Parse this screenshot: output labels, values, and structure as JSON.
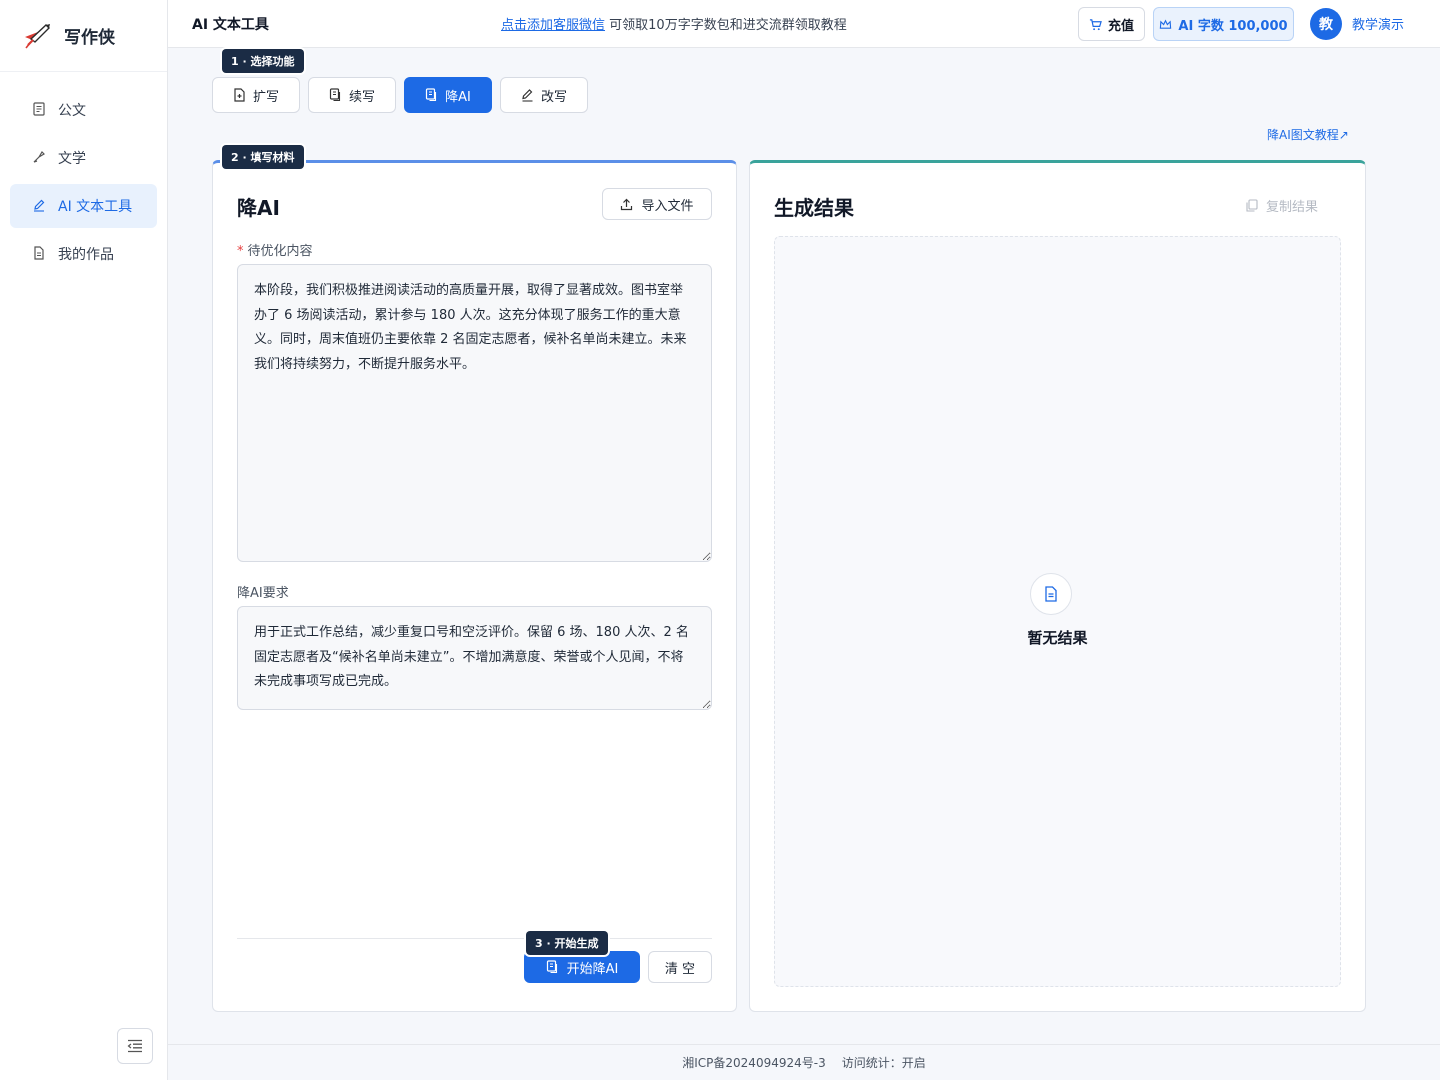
{
  "app": {
    "name": "写作侠",
    "logo_icon": "rocket-pen-logo"
  },
  "sidebar": {
    "items": [
      {
        "label": "公文",
        "icon": "document-list-icon",
        "active": false
      },
      {
        "label": "文学",
        "icon": "quill-icon",
        "active": false
      },
      {
        "label": "AI 文本工具",
        "icon": "pen-icon",
        "active": true
      },
      {
        "label": "我的作品",
        "icon": "file-icon",
        "active": false
      }
    ],
    "collapse_icon": "collapse-menu-icon"
  },
  "header": {
    "title": "AI 文本工具",
    "promo_link": "点击添加客服微信",
    "promo_text": "可领取10万字字数包和进交流群领取教程",
    "recharge_label": "充值",
    "quota_label": "AI 字数 100,000",
    "avatar_text": "教",
    "user_name": "教学演示"
  },
  "steps": {
    "step1": "1 · 选择功能",
    "step2": "2 · 填写材料",
    "step3": "3 · 开始生成"
  },
  "tabs": [
    {
      "label": "扩写",
      "icon": "file-plus-icon",
      "active": false
    },
    {
      "label": "续写",
      "icon": "file-copy-icon",
      "active": false
    },
    {
      "label": "降AI",
      "icon": "file-ai-icon",
      "active": true
    },
    {
      "label": "改写",
      "icon": "edit-icon",
      "active": false
    }
  ],
  "tutorial_link": "降AI图文教程↗",
  "left_panel": {
    "title": "降AI",
    "import_label": "导入文件",
    "content_label": "待优化内容",
    "content_value": "本阶段，我们积极推进阅读活动的高质量开展，取得了显著成效。图书室举办了 6 场阅读活动，累计参与 180 人次。这充分体现了服务工作的重大意义。同时，周末值班仍主要依靠 2 名固定志愿者，候补名单尚未建立。未来我们将持续努力，不断提升服务水平。",
    "req_label": "降AI要求",
    "req_value": "用于正式工作总结，减少重复口号和空泛评价。保留 6 场、180 人次、2 名固定志愿者及“候补名单尚未建立”。不增加满意度、荣誉或个人见闻，不将未完成事项写成已完成。",
    "start_label": "开始降AI",
    "clear_label": "清 空"
  },
  "right_panel": {
    "title": "生成结果",
    "copy_label": "复制结果",
    "empty_text": "暂无结果"
  },
  "footer": {
    "icp": "湘ICP备2024094924号-3",
    "stats": "访问统计：开启"
  },
  "colors": {
    "accent": "#1d6ae5",
    "step_badge": "#1b2c45",
    "left_border": "#5b8fe8",
    "right_border": "#3aa39b"
  }
}
